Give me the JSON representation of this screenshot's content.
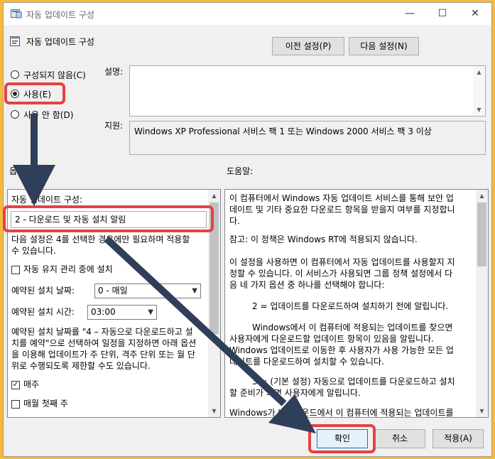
{
  "window": {
    "title": "자동 업데이트 구성",
    "controls": {
      "minimize": "—",
      "maximize": "☐",
      "close": "✕"
    }
  },
  "header": {
    "policy_title": "자동 업데이트 구성",
    "prev_button": "이전 설정(P)",
    "next_button": "다음 설정(N)"
  },
  "state_options": [
    {
      "label": "구성되지 않음(C)",
      "selected": false
    },
    {
      "label": "사용(E)",
      "selected": true
    },
    {
      "label": "사용 안 함(D)",
      "selected": false
    }
  ],
  "comment_label": "설명:",
  "comment_value": "",
  "supported_label": "지원:",
  "supported_value": "Windows XP Professional 서비스 팩 1 또는 Windows 2000 서비스 팩 3 이상",
  "options_label": "옵션:",
  "help_label": "도움말:",
  "options": {
    "config_label": "자동 업데이트 구성:",
    "config_value": "2 - 다운로드 및 자동 설치 알림",
    "note1_l1": "다음 설정은 4를 선택한 경우에만 필요하며 적용할",
    "note1_l2": "수 있습니다.",
    "maintenance_checkbox": "자동 유지 관리 중에 설치",
    "maintenance_checked": false,
    "day_label": "예약된 설치 날짜:",
    "day_value": "0 - 매일",
    "time_label": "예약된 설치 시간:",
    "time_value": "03:00",
    "note2_l1": "예약된 설치 날짜를 \"4 – 자동으로 다운로드하고 설",
    "note2_l2": "치를 예약\"으로 선택하여 일정을 지정하면 아래 옵션",
    "note2_l3": "을 이용해 업데이트가 주 단위, 격주 단위 또는 월 단",
    "note2_l4": "위로 수행되도록 제한할 수도 있습니다.",
    "weekly_checkbox": "매주",
    "weekly_checked": true,
    "monthly_first_checkbox": "매월 첫째 주",
    "monthly_first_checked": false
  },
  "help": {
    "p1_l1": "이 컴퓨터에서 Windows 자동 업데이트 서비스를 통해 보안 업",
    "p1_l2": "데이트 및 기타 중요한 다운로드 항목을 받을지 여부를 지정합니",
    "p1_l3": "다.",
    "p2_l1": "참고: 이 정책은 Windows RT에 적용되지 않습니다.",
    "p3_l1": "이 설정을 사용하면 이 컴퓨터에서 자동 업데이트를 사용할지 지",
    "p3_l2": "정할 수 있습니다. 이 서비스가 사용되면 그룹 정책 설정에서 다",
    "p3_l3": "음 네 가지 옵션 중 하나를 선택해야 합니다:",
    "p4_l1": "2 = 업데이트를 다운로드하여 설치하기 전에 알립니다.",
    "p5_l1": "Windows에서 이 컴퓨터에 적용되는 업데이트를 찾으면",
    "p5_l2": "사용자에게 다운로드할 업데이트 항목이 있음을 알립니다.",
    "p5_l3": "Windows 업데이트로 이동한 후 사용자가 사용 가능한 모든 업",
    "p5_l4": "데이트를 다운로드하여 설치할 수 있습니다.",
    "p6_l1": "3 = (기본 설정) 자동으로 업데이트를 다운로드하고 설치",
    "p6_l2": "할 준비가 되면 사용자에게 알립니다.",
    "p7_l1": "Windows가 백그라운드에서 이 컴퓨터에 적용되는 업데이트를"
  },
  "footer": {
    "ok_button": "확인",
    "cancel_button": "취소",
    "apply_button": "적용(A)"
  },
  "colors": {
    "background": "#f7b93c",
    "window": "#f0f0f0",
    "highlight": "#e24444",
    "arrow": "#2f3e59"
  }
}
